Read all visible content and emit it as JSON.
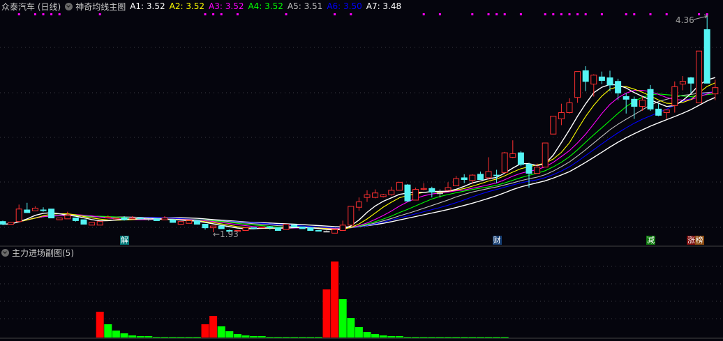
{
  "header": {
    "stock": "众泰汽车 (日线)",
    "indicator": "神奇均线主图",
    "ma": [
      {
        "label": "A1:",
        "value": "3.52",
        "color": "#ffffff"
      },
      {
        "label": "A2:",
        "value": "3.52",
        "color": "#ffff00"
      },
      {
        "label": "A3:",
        "value": "3.52",
        "color": "#ff00ff"
      },
      {
        "label": "A4:",
        "value": "3.52",
        "color": "#00ff00"
      },
      {
        "label": "A5:",
        "value": "3.51",
        "color": "#c0c0c0"
      },
      {
        "label": "A6:",
        "value": "3.50",
        "color": "#0000ff"
      },
      {
        "label": "A7:",
        "value": "3.48",
        "color": "#ffffff"
      }
    ]
  },
  "sub": {
    "title": "主力进场副图(5)"
  },
  "annotations": {
    "high_label": "4.36",
    "low_label": "←1.93"
  },
  "markers": [
    {
      "text": "解",
      "index": 15,
      "color": "#007878"
    },
    {
      "text": "财",
      "index": 61,
      "color": "#163e72"
    },
    {
      "text": "减",
      "index": 80,
      "color": "#0e780e"
    },
    {
      "text": "涨",
      "index": 85,
      "color": "#7a0a0a"
    },
    {
      "text": "榜",
      "index": 86,
      "color": "#8a4a10"
    }
  ],
  "chart_data": [
    {
      "type": "candlestick",
      "title": "众泰汽车 (日线)",
      "price_range": [
        1.93,
        4.36
      ],
      "up_color": "#ff3030",
      "down_color": "#54f4f4",
      "ohlc": [
        [
          2.05,
          2.02,
          2.06,
          2.01
        ],
        [
          2.02,
          2.04,
          2.04,
          2.02
        ],
        [
          2.05,
          2.19,
          2.24,
          2.05
        ],
        [
          2.18,
          2.15,
          2.26,
          2.15
        ],
        [
          2.17,
          2.2,
          2.22,
          2.17
        ],
        [
          2.18,
          2.18,
          2.21,
          2.16
        ],
        [
          2.19,
          2.09,
          2.19,
          2.09
        ],
        [
          2.07,
          2.09,
          2.09,
          2.07
        ],
        [
          2.08,
          2.12,
          2.16,
          2.08
        ],
        [
          2.09,
          2.06,
          2.09,
          2.05
        ],
        [
          2.07,
          2.02,
          2.07,
          2.02
        ],
        [
          2.01,
          2.04,
          2.04,
          2.01
        ],
        [
          2.01,
          2.05,
          2.05,
          2.01
        ],
        [
          2.09,
          2.1,
          2.12,
          2.09
        ],
        [
          2.08,
          2.09,
          2.09,
          2.08
        ],
        [
          2.09,
          2.07,
          2.11,
          2.06
        ],
        [
          2.08,
          2.09,
          2.11,
          2.08
        ],
        [
          2.09,
          2.08,
          2.09,
          2.08
        ],
        [
          2.08,
          2.08,
          2.08,
          2.06
        ],
        [
          2.08,
          2.06,
          2.08,
          2.06
        ],
        [
          2.07,
          2.09,
          2.11,
          2.07
        ],
        [
          2.07,
          2.04,
          2.07,
          2.04
        ],
        [
          2.02,
          2.05,
          2.05,
          2.02
        ],
        [
          2.03,
          2.06,
          2.06,
          2.03
        ],
        [
          2.06,
          2.02,
          2.06,
          2.02
        ],
        [
          2.02,
          1.98,
          2.02,
          1.96
        ],
        [
          1.98,
          2.0,
          2.0,
          1.93
        ],
        [
          2.0,
          1.97,
          2.0,
          1.97
        ],
        [
          1.95,
          1.94,
          1.96,
          1.93
        ],
        [
          1.94,
          1.95,
          1.95,
          1.94
        ],
        [
          1.95,
          1.98,
          1.98,
          1.95
        ],
        [
          1.98,
          1.98,
          1.98,
          1.98
        ],
        [
          1.98,
          1.99,
          1.99,
          1.98
        ],
        [
          1.99,
          1.98,
          2.0,
          1.96
        ],
        [
          1.98,
          1.95,
          1.98,
          1.95
        ],
        [
          1.96,
          2.02,
          2.02,
          1.96
        ],
        [
          2.01,
          1.99,
          2.01,
          1.99
        ],
        [
          1.99,
          1.97,
          1.99,
          1.97
        ],
        [
          1.98,
          1.95,
          1.98,
          1.95
        ],
        [
          1.95,
          1.95,
          1.95,
          1.95
        ],
        [
          1.94,
          1.94,
          1.95,
          1.93
        ],
        [
          1.92,
          1.96,
          1.96,
          1.92
        ],
        [
          1.95,
          2.01,
          2.06,
          1.95
        ],
        [
          2.01,
          2.22,
          2.22,
          2.01
        ],
        [
          2.21,
          2.27,
          2.32,
          2.17
        ],
        [
          2.32,
          2.35,
          2.4,
          2.27
        ],
        [
          2.32,
          2.37,
          2.41,
          2.31
        ],
        [
          2.33,
          2.35,
          2.36,
          2.32
        ],
        [
          2.35,
          2.4,
          2.44,
          2.34
        ],
        [
          2.4,
          2.49,
          2.49,
          2.4
        ],
        [
          2.46,
          2.28,
          2.47,
          2.27
        ],
        [
          2.29,
          2.41,
          2.43,
          2.29
        ],
        [
          2.41,
          2.42,
          2.48,
          2.4
        ],
        [
          2.42,
          2.38,
          2.44,
          2.32
        ],
        [
          2.37,
          2.37,
          2.41,
          2.32
        ],
        [
          2.4,
          2.43,
          2.49,
          2.4
        ],
        [
          2.45,
          2.53,
          2.56,
          2.45
        ],
        [
          2.54,
          2.52,
          2.58,
          2.48
        ],
        [
          2.51,
          2.57,
          2.58,
          2.47
        ],
        [
          2.58,
          2.52,
          2.61,
          2.52
        ],
        [
          2.54,
          2.61,
          2.77,
          2.52
        ],
        [
          2.57,
          2.57,
          2.63,
          2.48
        ],
        [
          2.6,
          2.82,
          2.83,
          2.59
        ],
        [
          2.77,
          2.81,
          2.96,
          2.76
        ],
        [
          2.82,
          2.69,
          2.84,
          2.67
        ],
        [
          2.69,
          2.59,
          2.71,
          2.43
        ],
        [
          2.59,
          2.66,
          2.7,
          2.59
        ],
        [
          2.66,
          2.93,
          2.93,
          2.66
        ],
        [
          3.03,
          3.23,
          3.23,
          3.03
        ],
        [
          3.2,
          3.27,
          3.37,
          3.13
        ],
        [
          3.27,
          3.38,
          3.43,
          3.26
        ],
        [
          3.44,
          3.73,
          3.73,
          3.38
        ],
        [
          3.74,
          3.62,
          3.79,
          3.51
        ],
        [
          3.59,
          3.69,
          3.7,
          3.45
        ],
        [
          3.67,
          3.63,
          3.73,
          3.59
        ],
        [
          3.66,
          3.58,
          3.74,
          3.51
        ],
        [
          3.62,
          3.49,
          3.65,
          3.41
        ],
        [
          3.45,
          3.42,
          3.49,
          3.26
        ],
        [
          3.42,
          3.34,
          3.45,
          3.2
        ],
        [
          3.34,
          3.41,
          3.45,
          3.29
        ],
        [
          3.53,
          3.31,
          3.58,
          3.29
        ],
        [
          3.31,
          3.24,
          3.37,
          3.23
        ],
        [
          3.27,
          3.3,
          3.3,
          3.2
        ],
        [
          3.35,
          3.56,
          3.62,
          3.27
        ],
        [
          3.59,
          3.62,
          3.68,
          3.52
        ],
        [
          3.66,
          3.6,
          3.67,
          3.49
        ],
        [
          3.38,
          3.96,
          3.96,
          3.38
        ],
        [
          4.2,
          3.6,
          4.36,
          3.6
        ],
        [
          3.48,
          3.55,
          3.64,
          3.41
        ]
      ],
      "ma_periods": [
        3,
        5,
        8,
        11,
        14,
        17,
        21
      ],
      "signal_dot_indices": [
        2,
        4,
        5,
        6,
        7,
        12,
        25,
        26,
        27,
        29,
        35,
        41,
        43,
        52,
        54,
        58,
        60,
        61,
        62,
        64,
        67,
        68,
        69,
        70,
        71,
        72,
        74,
        77,
        78,
        80,
        82,
        86,
        87
      ],
      "signal_dot_color": "#ff00ff"
    },
    {
      "type": "bar",
      "title": "主力进场副图(5)",
      "ylim": [
        0,
        4.5
      ],
      "bars": [
        {
          "i": 12,
          "v": 1.48,
          "c": "red"
        },
        {
          "i": 13,
          "v": 0.76,
          "c": "green"
        },
        {
          "i": 14,
          "v": 0.4,
          "c": "green"
        },
        {
          "i": 15,
          "v": 0.24,
          "c": "green"
        },
        {
          "i": 16,
          "v": 0.12,
          "c": "green"
        },
        {
          "i": 17,
          "v": 0.08,
          "c": "green"
        },
        {
          "i": 18,
          "v": 0.08,
          "c": "green"
        },
        {
          "i": 19,
          "v": 0.04,
          "c": "green"
        },
        {
          "i": 20,
          "v": 0.04,
          "c": "green"
        },
        {
          "i": 21,
          "v": 0.04,
          "c": "green"
        },
        {
          "i": 22,
          "v": 0.04,
          "c": "green"
        },
        {
          "i": 23,
          "v": 0.04,
          "c": "green"
        },
        {
          "i": 24,
          "v": 0.04,
          "c": "green"
        },
        {
          "i": 25,
          "v": 0.76,
          "c": "red"
        },
        {
          "i": 26,
          "v": 1.24,
          "c": "red"
        },
        {
          "i": 27,
          "v": 0.64,
          "c": "green"
        },
        {
          "i": 28,
          "v": 0.36,
          "c": "green"
        },
        {
          "i": 29,
          "v": 0.2,
          "c": "green"
        },
        {
          "i": 30,
          "v": 0.12,
          "c": "green"
        },
        {
          "i": 31,
          "v": 0.08,
          "c": "green"
        },
        {
          "i": 32,
          "v": 0.08,
          "c": "green"
        },
        {
          "i": 33,
          "v": 0.04,
          "c": "green"
        },
        {
          "i": 34,
          "v": 0.04,
          "c": "green"
        },
        {
          "i": 35,
          "v": 0.04,
          "c": "green"
        },
        {
          "i": 36,
          "v": 0.04,
          "c": "green"
        },
        {
          "i": 37,
          "v": 0.04,
          "c": "green"
        },
        {
          "i": 38,
          "v": 0.04,
          "c": "green"
        },
        {
          "i": 39,
          "v": 0.04,
          "c": "green"
        },
        {
          "i": 40,
          "v": 2.76,
          "c": "red"
        },
        {
          "i": 41,
          "v": 4.36,
          "c": "red"
        },
        {
          "i": 42,
          "v": 2.2,
          "c": "green"
        },
        {
          "i": 43,
          "v": 1.12,
          "c": "green"
        },
        {
          "i": 44,
          "v": 0.6,
          "c": "green"
        },
        {
          "i": 45,
          "v": 0.32,
          "c": "green"
        },
        {
          "i": 46,
          "v": 0.2,
          "c": "green"
        },
        {
          "i": 47,
          "v": 0.12,
          "c": "green"
        },
        {
          "i": 48,
          "v": 0.08,
          "c": "green"
        },
        {
          "i": 49,
          "v": 0.08,
          "c": "green"
        },
        {
          "i": 50,
          "v": 0.04,
          "c": "green"
        },
        {
          "i": 51,
          "v": 0.04,
          "c": "green"
        },
        {
          "i": 52,
          "v": 0.04,
          "c": "green"
        },
        {
          "i": 53,
          "v": 0.04,
          "c": "green"
        },
        {
          "i": 54,
          "v": 0.04,
          "c": "green"
        },
        {
          "i": 55,
          "v": 0.04,
          "c": "green"
        },
        {
          "i": 56,
          "v": 0.04,
          "c": "green"
        },
        {
          "i": 57,
          "v": 0.04,
          "c": "green"
        },
        {
          "i": 58,
          "v": 0.04,
          "c": "green"
        },
        {
          "i": 59,
          "v": 0.04,
          "c": "green"
        },
        {
          "i": 60,
          "v": 0.04,
          "c": "green"
        },
        {
          "i": 61,
          "v": 0.04,
          "c": "green"
        },
        {
          "i": 62,
          "v": 0.04,
          "c": "green"
        }
      ]
    }
  ]
}
